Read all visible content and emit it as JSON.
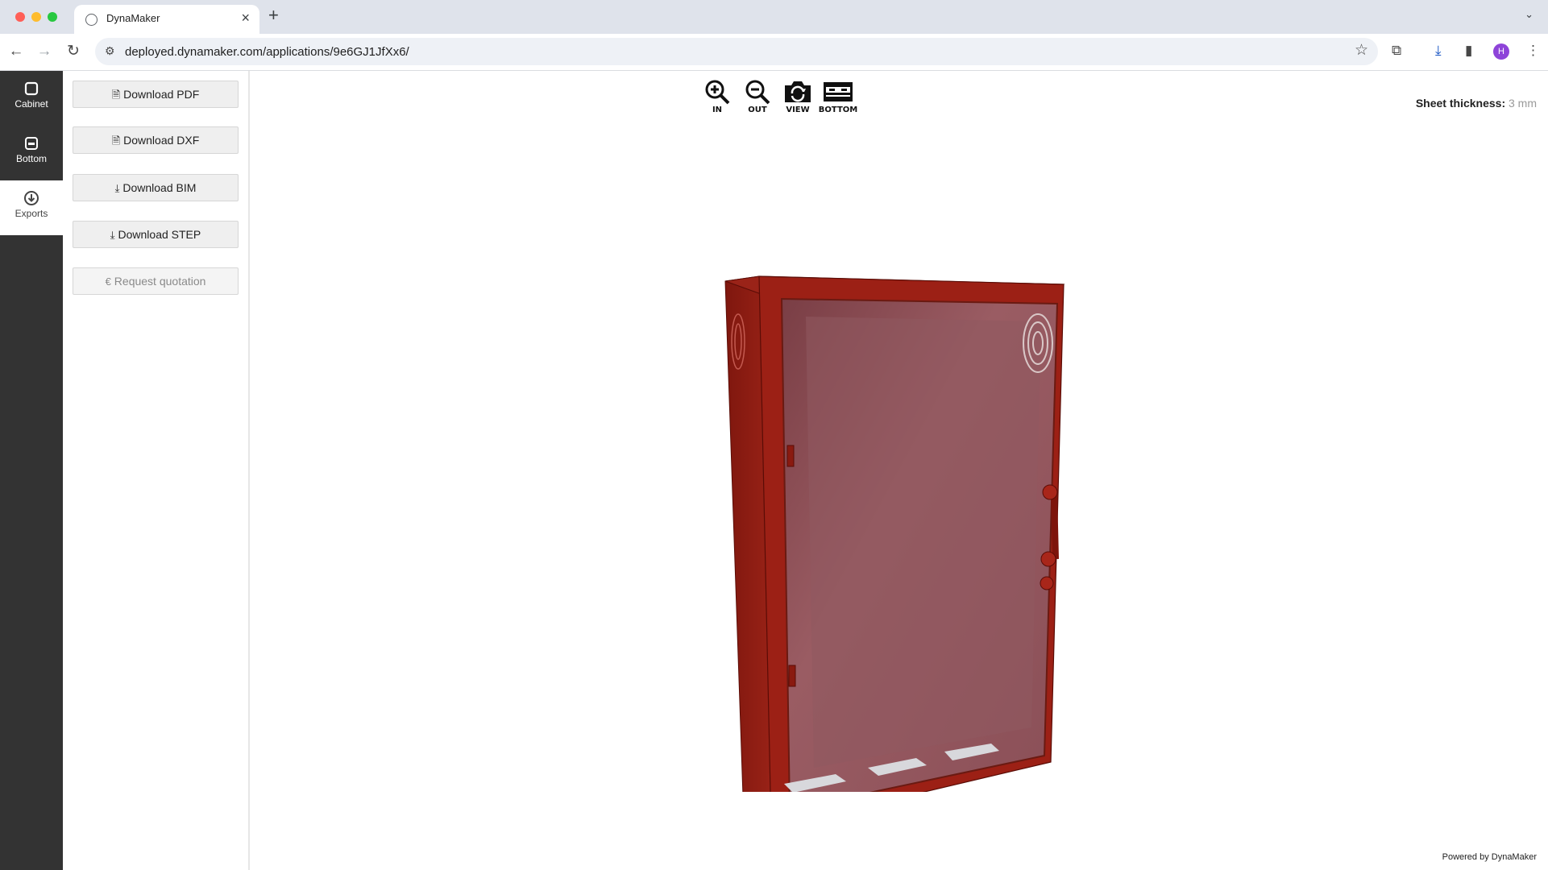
{
  "browser": {
    "tab_title": "DynaMaker",
    "tab_close": "×",
    "new_tab": "+",
    "url_host": "deployed.dynamaker.com",
    "url_path": "/applications/9e6GJ1JfXx6/",
    "avatar_letter": "H",
    "nav": {
      "back": "←",
      "forward": "→",
      "reload": "↻"
    }
  },
  "rail": {
    "items": [
      {
        "label": "Cabinet",
        "icon": "cabinet-icon",
        "active": false
      },
      {
        "label": "Bottom",
        "icon": "bottom-icon",
        "active": false
      },
      {
        "label": "Exports",
        "icon": "download-circle-icon",
        "active": true
      }
    ]
  },
  "panel": {
    "buttons": [
      {
        "label": "Download PDF",
        "icon": "file-icon"
      },
      {
        "label": "Download DXF",
        "icon": "file-icon"
      },
      {
        "label": "Download BIM",
        "icon": "download-icon"
      },
      {
        "label": "Download STEP",
        "icon": "download-icon"
      },
      {
        "label": "Request quotation",
        "icon": "euro-icon",
        "disabled": true
      }
    ]
  },
  "viewer": {
    "controls": [
      {
        "label": "IN",
        "icon": "zoom-in-icon"
      },
      {
        "label": "OUT",
        "icon": "zoom-out-icon"
      },
      {
        "label": "VIEW",
        "icon": "camera-rotate-icon"
      },
      {
        "label": "BOTTOM",
        "icon": "bottom-view-icon"
      }
    ],
    "sheet_thickness_label": "Sheet thickness:",
    "sheet_thickness_value": "3 mm",
    "powered_by": "Powered by DynaMaker"
  },
  "colors": {
    "cabinet_frame": "#8e1a10",
    "glass": "#8a4a52",
    "rail_bg": "#333333"
  }
}
